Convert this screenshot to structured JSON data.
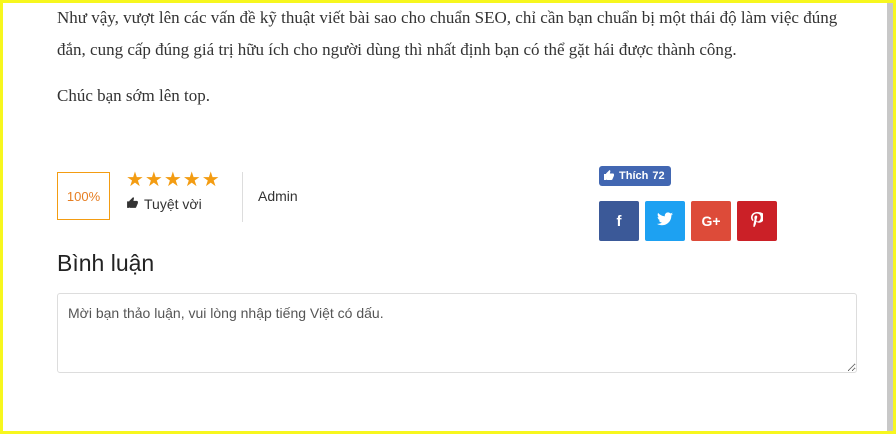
{
  "article": {
    "paragraphs": [
      "Như vậy, vượt lên các vấn đề kỹ thuật viết bài sao cho chuẩn SEO, chỉ cần bạn chuẩn bị một thái độ làm việc đúng đắn, cung cấp đúng giá trị hữu ích cho người dùng thì nhất định bạn có thể gặt hái được thành công.",
      "Chúc bạn sớm lên top."
    ]
  },
  "rating": {
    "percent_label": "100%",
    "stars": 5,
    "stars_text": "★★★★★",
    "verdict": "Tuyệt vời"
  },
  "author": {
    "name": "Admin"
  },
  "social": {
    "like_label": "Thích",
    "like_count": "72",
    "facebook_color": "#3b5998",
    "twitter_color": "#1da1f2",
    "google_plus_color": "#dd4b39",
    "pinterest_color": "#cb2027"
  },
  "comments": {
    "title": "Bình luận",
    "placeholder": "Mời bạn thảo luận, vui lòng nhập tiếng Việt có dấu."
  },
  "colors": {
    "accent": "#f39c12",
    "frame": "#f7f71e"
  }
}
